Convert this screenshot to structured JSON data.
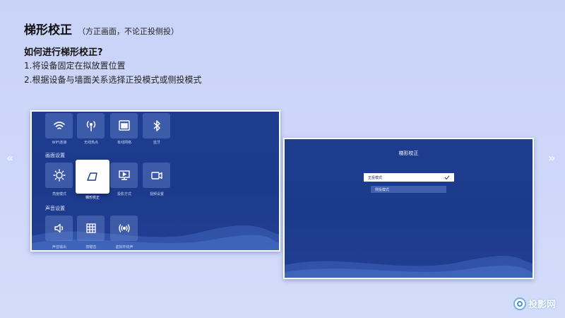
{
  "header": {
    "title": "梯形校正",
    "subtitle": "（方正画面，不论正投侧投）",
    "question": "如何进行梯形校正?",
    "steps": [
      "1.将设备固定在拟放置位置",
      "2.根据设备与墙面关系选择正投模式或侧投模式"
    ]
  },
  "nav": {
    "prev": "«",
    "next": "»"
  },
  "left_screen": {
    "network_row": [
      {
        "label": "WIFI连接",
        "icon": "wifi-icon"
      },
      {
        "label": "无线热点",
        "icon": "hotspot-icon"
      },
      {
        "label": "有线网络",
        "icon": "ethernet-icon"
      },
      {
        "label": "蓝牙",
        "icon": "bluetooth-icon"
      }
    ],
    "picture_section": "画面设置",
    "picture_row": [
      {
        "label": "亮度模式",
        "icon": "brightness-icon"
      },
      {
        "label": "梯形校正",
        "icon": "keystone-icon",
        "active": true
      },
      {
        "label": "投影方式",
        "icon": "projection-icon"
      },
      {
        "label": "视频设置",
        "icon": "video-icon"
      }
    ],
    "sound_section": "声音设置",
    "sound_row": [
      {
        "label": "声音输出",
        "icon": "speaker-icon"
      },
      {
        "label": "按键音",
        "icon": "keypad-icon"
      },
      {
        "label": "虚拟环绕声",
        "icon": "surround-icon"
      }
    ]
  },
  "right_screen": {
    "title": "梯形校正",
    "options": [
      {
        "label": "正投模式",
        "selected": true
      },
      {
        "label": "侧投模式",
        "selected": false
      }
    ]
  },
  "logo": {
    "text": "投影网"
  },
  "colors": {
    "panel_bg": "#1e3d8f",
    "page_bg": "#cbd5f8",
    "accent": "#ffffff"
  }
}
